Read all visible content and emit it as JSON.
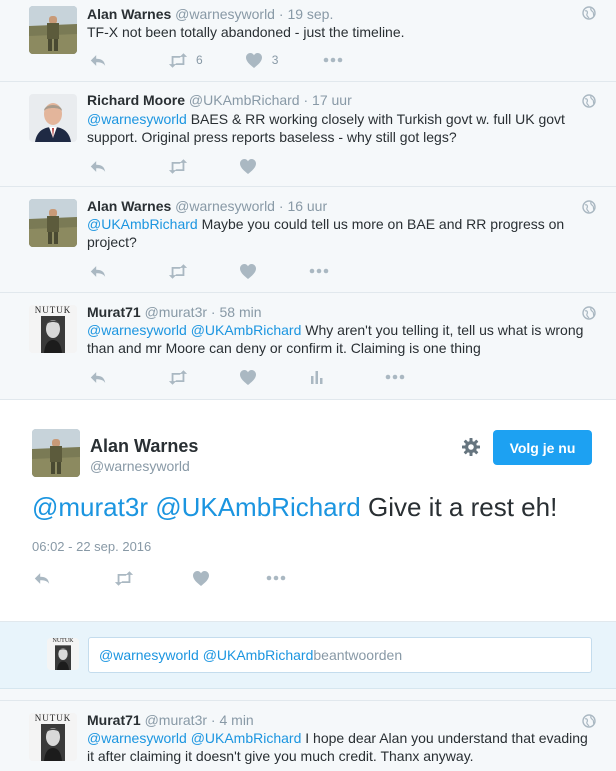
{
  "tweets": [
    {
      "name": "Alan Warnes",
      "handle": "@warnesyworld",
      "sep": "·",
      "time": "19 sep.",
      "mentions": "",
      "text": "TF-X not been totally abandoned - just the timeline.",
      "text2": "",
      "retweets": "6",
      "likes": "3"
    },
    {
      "name": "Richard Moore",
      "handle": "@UKAmbRichard",
      "sep": "·",
      "time": "17 uur",
      "mentions": "@warnesyworld",
      "text": " BAES & RR working closely with Turkish govt w. full UK govt",
      "text2": "support. Original press reports baseless - why still got legs?",
      "retweets": "",
      "likes": ""
    },
    {
      "name": "Alan Warnes",
      "handle": "@warnesyworld",
      "sep": "·",
      "time": "16 uur",
      "mentions": "@UKAmbRichard",
      "text": " Maybe you could tell us more on BAE and RR progress on",
      "text2": "project?",
      "retweets": "",
      "likes": ""
    },
    {
      "name": "Murat71",
      "handle": "@murat3r",
      "sep": "·",
      "time": "58 min",
      "mentions": "@warnesyworld @UKAmbRichard",
      "text": " Why aren't you telling it, tell us what is wrong",
      "text2": "than and mr Moore can deny or confirm it. Claiming is one thing",
      "retweets": "",
      "likes": ""
    }
  ],
  "main_tweet": {
    "name": "Alan Warnes",
    "handle": "@warnesyworld",
    "follow_label": "Volg je nu",
    "mentions": "@murat3r @UKAmbRichard",
    "text": " Give it a rest eh!",
    "timestamp": "06:02 - 22 sep. 2016"
  },
  "reply": {
    "mentions": "@warnesyworld @UKAmbRichard",
    "placeholder": " beantwoorden"
  },
  "last_tweet": {
    "name": "Murat71",
    "handle": "@murat3r",
    "sep": "·",
    "time": "4 min",
    "mentions": "@warnesyworld @UKAmbRichard",
    "text": " I hope dear Alan you understand that evading",
    "text2": "it after claiming it doesn't give you much credit. Thanx anyway."
  },
  "avatar_caption": "NUTUK",
  "colors": {
    "accent": "#1da1f2",
    "mention": "#1b95e0",
    "icon": "#aab8c2"
  }
}
